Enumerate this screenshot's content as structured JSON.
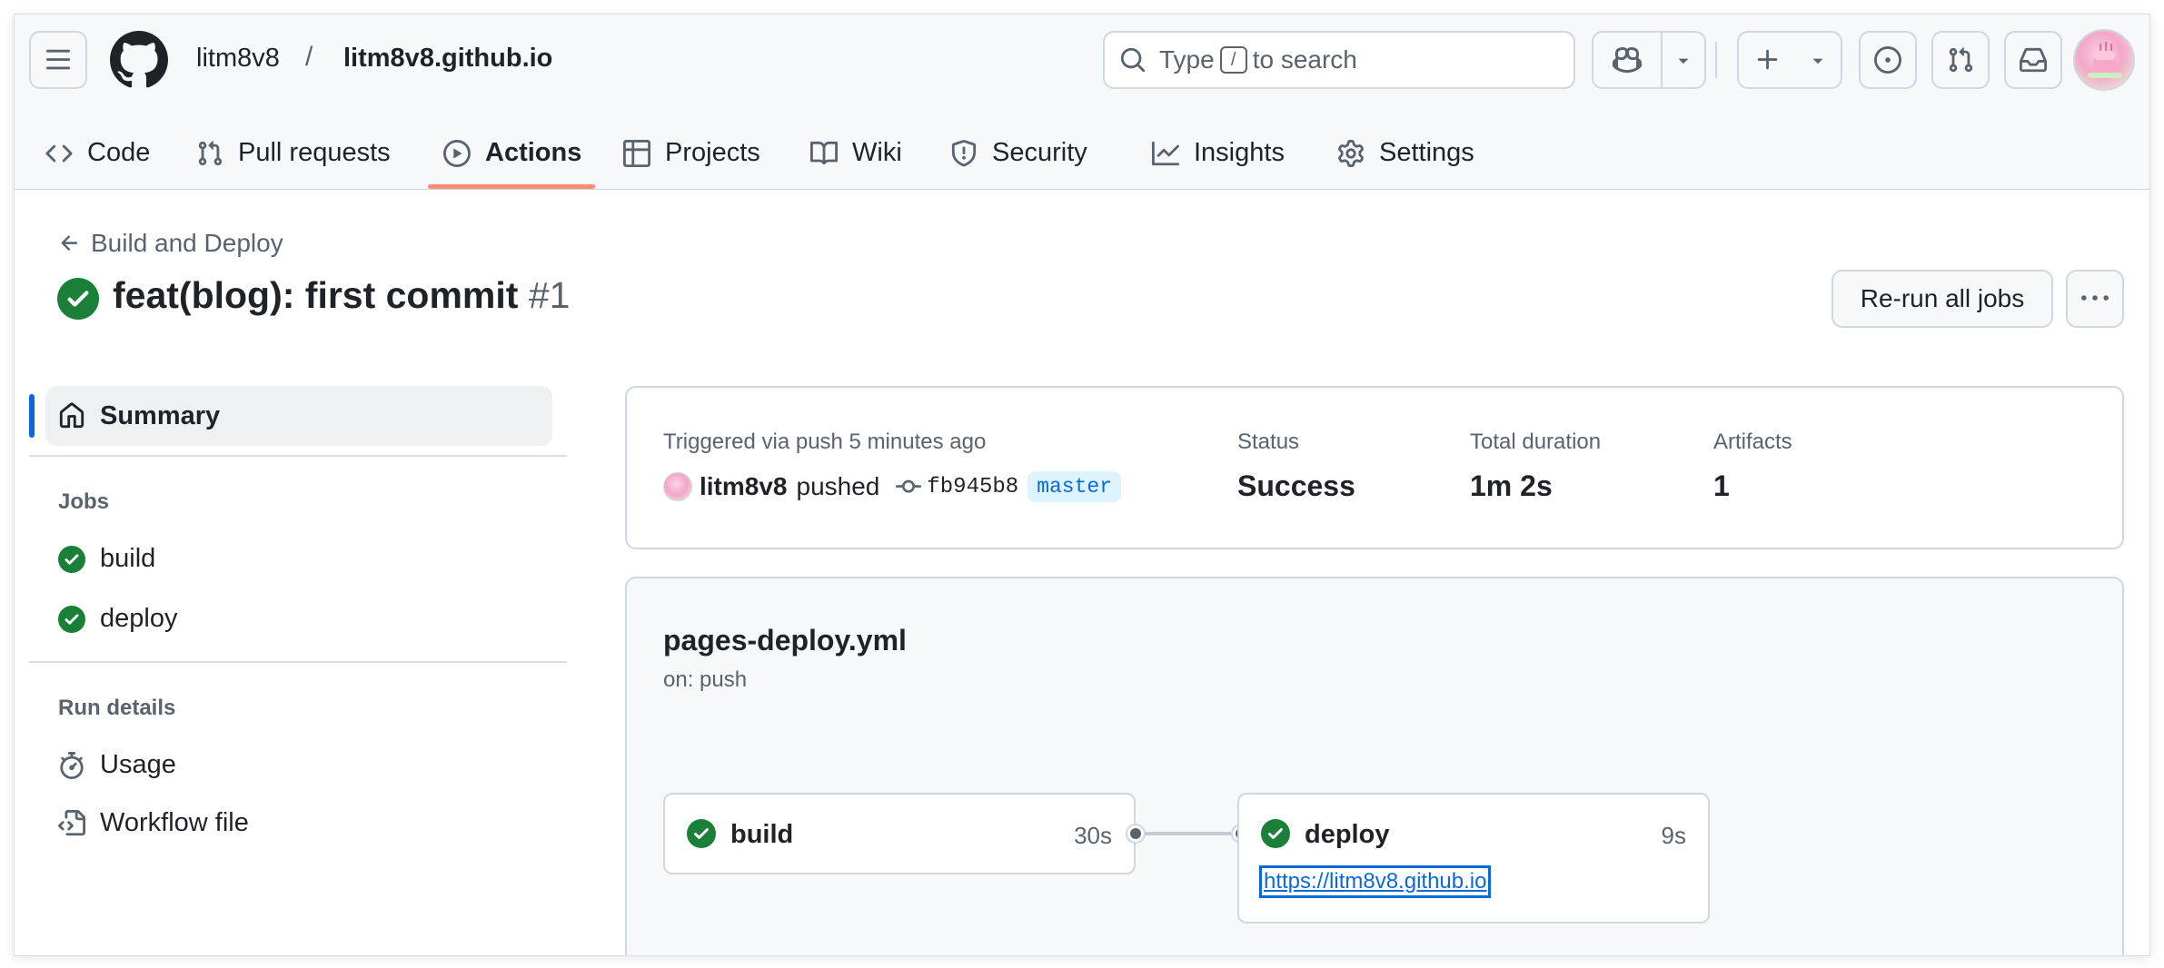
{
  "header": {
    "owner": "litm8v8",
    "separator": "/",
    "repo": "litm8v8.github.io",
    "search": {
      "prefix": "Type",
      "key": "/",
      "suffix": "to search"
    }
  },
  "tabs": [
    {
      "label": "Code",
      "icon": "code-icon"
    },
    {
      "label": "Pull requests",
      "icon": "git-pull-request-icon"
    },
    {
      "label": "Actions",
      "icon": "play-icon",
      "active": true
    },
    {
      "label": "Projects",
      "icon": "table-icon"
    },
    {
      "label": "Wiki",
      "icon": "book-icon"
    },
    {
      "label": "Security",
      "icon": "shield-icon"
    },
    {
      "label": "Insights",
      "icon": "graph-icon"
    },
    {
      "label": "Settings",
      "icon": "gear-icon"
    }
  ],
  "run": {
    "back_label": "Build and Deploy",
    "title": "feat(blog): first commit",
    "number": "#1",
    "rerun_label": "Re-run all jobs"
  },
  "sidebar": {
    "summary": "Summary",
    "jobs_heading": "Jobs",
    "jobs": [
      "build",
      "deploy"
    ],
    "run_details_heading": "Run details",
    "details": [
      "Usage",
      "Workflow file"
    ]
  },
  "summary": {
    "triggered": "Triggered via push 5 minutes ago",
    "actor": "litm8v8",
    "action": "pushed",
    "commit": "fb945b8",
    "branch": "master",
    "status_label": "Status",
    "status_value": "Success",
    "duration_label": "Total duration",
    "duration_value": "1m 2s",
    "artifacts_label": "Artifacts",
    "artifacts_value": "1"
  },
  "workflow": {
    "file": "pages-deploy.yml",
    "trigger": "on: push",
    "jobs": [
      {
        "name": "build",
        "time": "30s"
      },
      {
        "name": "deploy",
        "time": "9s",
        "link": "https://litm8v8.github.io"
      }
    ]
  },
  "colors": {
    "success": "#1a7f37",
    "accent": "#0969da",
    "tab_underline": "#fd8c73"
  }
}
